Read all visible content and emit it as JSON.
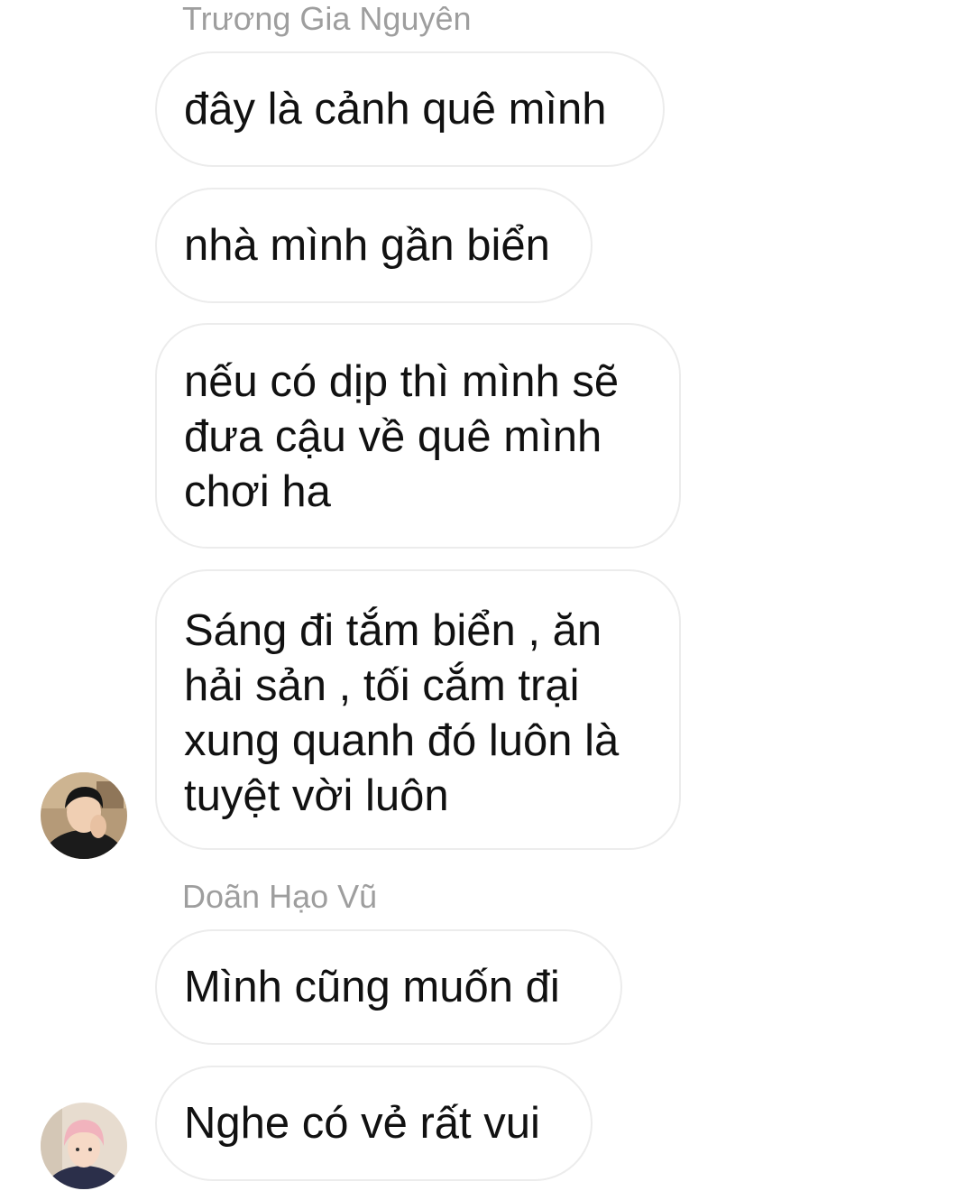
{
  "conversation": {
    "groups": [
      {
        "sender": "Trương Gia Nguyên",
        "avatar_icon": "user-avatar-dark-hair-icon",
        "messages": [
          "đây là cảnh quê mình",
          "nhà mình gần biển",
          "nếu có dịp thì mình sẽ\nđưa cậu về quê mình\nchơi ha",
          "Sáng đi tắm biển , ăn\nhải sản , tối cắm trại\nxung quanh đó luôn là\ntuyệt vời luôn"
        ]
      },
      {
        "sender": "Doãn Hạo Vũ",
        "avatar_icon": "user-avatar-pink-hair-icon",
        "messages": [
          "Mình cũng muốn đi",
          "Nghe có vẻ rất vui"
        ]
      }
    ]
  },
  "colors": {
    "sender_name": "#9e9e9e",
    "bubble_border": "#ececec",
    "message_text": "#111111"
  }
}
